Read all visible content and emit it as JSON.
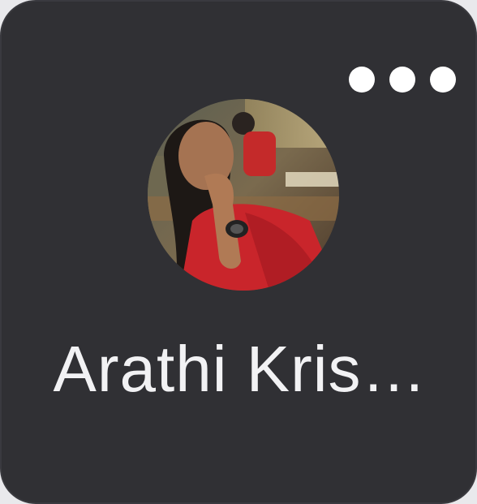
{
  "contact": {
    "name": "Arathi Kris…",
    "avatar_icon": "user-photo-avatar"
  },
  "menu": {
    "icon": "more-horizontal-icon"
  },
  "colors": {
    "tile_bg": "#303034",
    "text": "#f2f2f4",
    "dots": "#ffffff"
  }
}
